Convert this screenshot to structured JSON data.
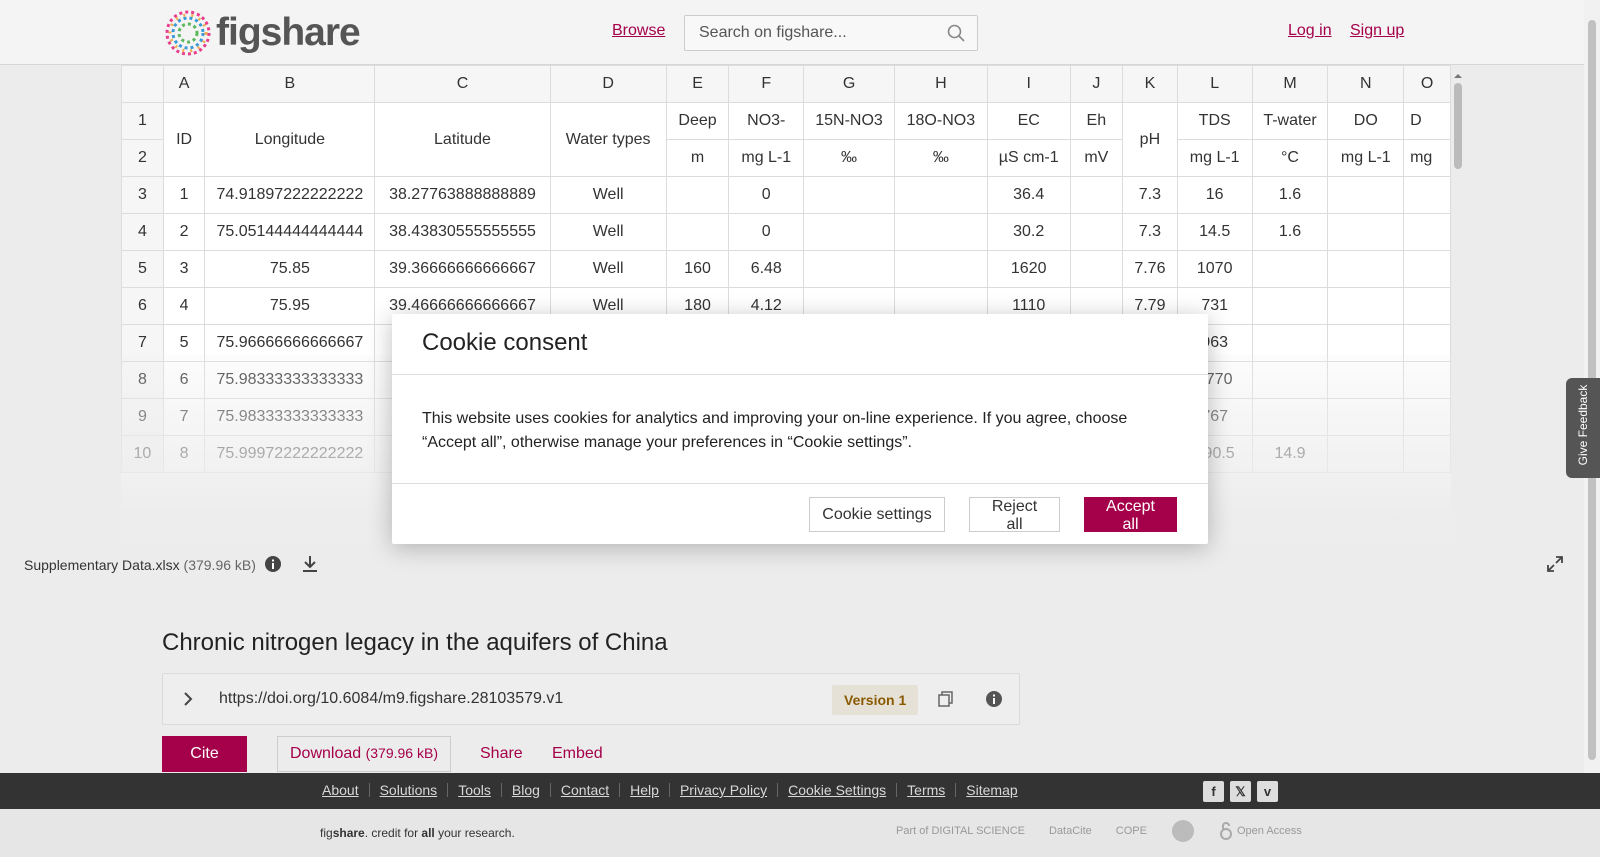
{
  "header": {
    "logo_text": "figshare",
    "browse": "Browse",
    "search_placeholder": "Search on figshare...",
    "login": "Log in",
    "signup": "Sign up"
  },
  "sheet": {
    "columns": [
      "",
      "A",
      "B",
      "C",
      "D",
      "E",
      "F",
      "G",
      "H",
      "I",
      "J",
      "K",
      "L",
      "M",
      "N",
      "O"
    ],
    "header_row1": [
      "1",
      "ID",
      "Longitude",
      "Latitude",
      "Water types",
      "Deep",
      "NO3-",
      "15N-NO3",
      "18O-NO3",
      "EC",
      "Eh",
      "pH",
      "TDS",
      "T-water",
      "DO",
      "D"
    ],
    "header_row2": [
      "2",
      "m",
      "mg L-1",
      "‰",
      "‰",
      "µS cm-1",
      "mV",
      "mg L-1",
      "°C",
      "mg L-1",
      "mg"
    ],
    "rows": [
      [
        "3",
        "1",
        "74.91897222222222",
        "38.27763888888889",
        "Well",
        "",
        "0",
        "",
        "",
        "36.4",
        "",
        "7.3",
        "16",
        "1.6",
        "",
        ""
      ],
      [
        "4",
        "2",
        "75.05144444444444",
        "38.43830555555555",
        "Well",
        "",
        "0",
        "",
        "",
        "30.2",
        "",
        "7.3",
        "14.5",
        "1.6",
        "",
        ""
      ],
      [
        "5",
        "3",
        "75.85",
        "39.36666666666667",
        "Well",
        "160",
        "6.48",
        "",
        "",
        "1620",
        "",
        "7.76",
        "1070",
        "",
        "",
        ""
      ],
      [
        "6",
        "4",
        "75.95",
        "39.46666666666667",
        "Well",
        "180",
        "4.12",
        "",
        "",
        "1110",
        "",
        "7.79",
        "731",
        "",
        "",
        ""
      ],
      [
        "7",
        "5",
        "75.96666666666667",
        "",
        "",
        "",
        "",
        "",
        "",
        "",
        "",
        "",
        "963",
        "",
        "",
        ""
      ],
      [
        "8",
        "6",
        "75.98333333333333",
        "",
        "",
        "",
        "",
        "",
        "",
        "",
        "",
        "",
        "1770",
        "",
        "",
        ""
      ],
      [
        "9",
        "7",
        "75.98333333333333",
        "",
        "",
        "",
        "",
        "",
        "",
        "",
        "",
        "",
        "767",
        "",
        "",
        ""
      ],
      [
        "10",
        "8",
        "75.99972222222222",
        "",
        "",
        "",
        "",
        "",
        "",
        "",
        "",
        "",
        "890.5",
        "14.9",
        "",
        ""
      ]
    ]
  },
  "file": {
    "name": "Supplementary Data.xlsx",
    "size": "(379.96 kB)"
  },
  "article": {
    "title": "Chronic nitrogen legacy in the aquifers of China",
    "doi": "https://doi.org/10.6084/m9.figshare.28103579.v1",
    "version": "Version 1",
    "cite": "Cite",
    "download": "Download",
    "download_size": "(379.96 kB)",
    "share": "Share",
    "embed": "Embed"
  },
  "footer": {
    "links": [
      "About",
      "Solutions",
      "Tools",
      "Blog",
      "Contact",
      "Help",
      "Privacy Policy",
      "Cookie Settings",
      "Terms",
      "Sitemap"
    ],
    "tagline_pre": "fig",
    "tagline_brand": "share",
    "tagline_mid": ". credit for ",
    "tagline_all": "all",
    "tagline_post": " your research.",
    "partner_1": "Part of DIGITAL SCIENCE",
    "partner_2": "DataCite",
    "partner_3": "COPE",
    "partner_5": "Open Access"
  },
  "feedback": "Give Feedback",
  "cookie": {
    "title": "Cookie consent",
    "body": "This website uses cookies for analytics and improving your on-line experience. If you agree, choose “Accept all”, otherwise manage your preferences in “Cookie settings”.",
    "settings": "Cookie settings",
    "reject": "Reject all",
    "accept": "Accept all"
  },
  "colors": {
    "brand": "#a5004a",
    "footer_dark": "#333333"
  }
}
